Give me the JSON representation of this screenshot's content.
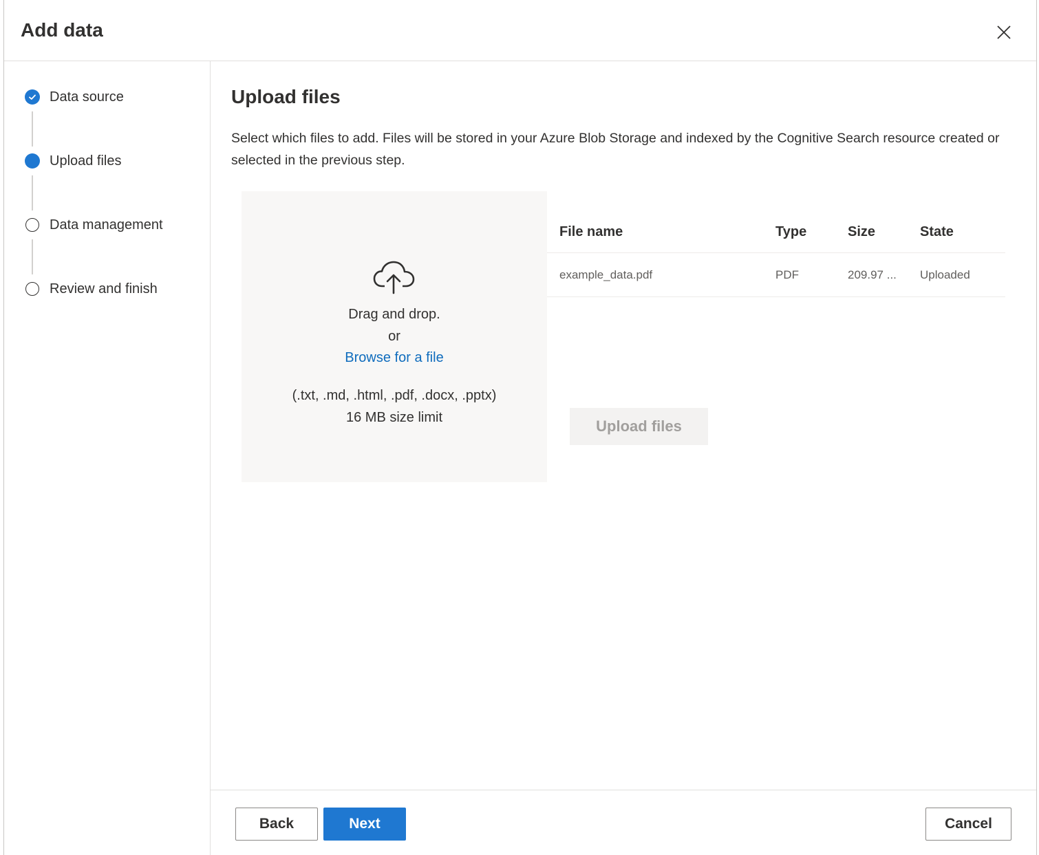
{
  "dialog": {
    "title": "Add data",
    "close_icon": "close-icon"
  },
  "steps": [
    {
      "label": "Data source",
      "status": "completed",
      "icon": "checkmark-icon"
    },
    {
      "label": "Upload files",
      "status": "current"
    },
    {
      "label": "Data management",
      "status": "pending"
    },
    {
      "label": "Review and finish",
      "status": "pending"
    }
  ],
  "main": {
    "title": "Upload files",
    "description": "Select which files to add. Files will be stored in your Azure Blob Storage and indexed by the Cognitive Search resource created or selected in the previous step."
  },
  "dropzone": {
    "icon": "cloud-upload-icon",
    "drag_text": "Drag and drop.",
    "or_text": "or",
    "browse_link": "Browse for a file",
    "formats": "(.txt, .md, .html, .pdf, .docx, .pptx)",
    "size_limit": "16 MB size limit"
  },
  "file_table": {
    "columns": [
      "File name",
      "Type",
      "Size",
      "State"
    ],
    "rows": [
      [
        "example_data.pdf",
        "PDF",
        "209.97 ...",
        "Uploaded"
      ]
    ]
  },
  "upload_button": {
    "label": "Upload files",
    "disabled": true
  },
  "footer": {
    "back_label": "Back",
    "next_label": "Next",
    "cancel_label": "Cancel"
  },
  "colors": {
    "accent": "#1f78d1",
    "link": "#0f6cbd",
    "dropzone_bg": "#f8f7f6",
    "disabled_text": "#a19f9d"
  }
}
